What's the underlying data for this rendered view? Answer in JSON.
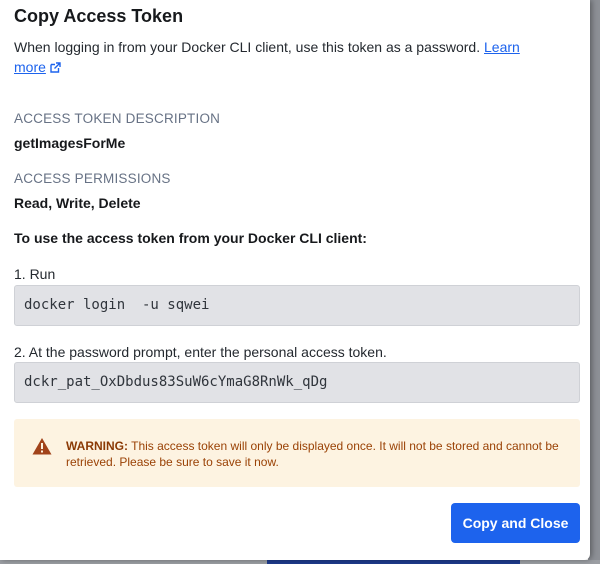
{
  "dialog": {
    "title": "Copy Access Token",
    "intro_text": "When logging in from your Docker CLI client, use this token as a password. ",
    "learn_more_label": "Learn more"
  },
  "token_description": {
    "label": "ACCESS TOKEN DESCRIPTION",
    "value": "getImagesForMe"
  },
  "permissions": {
    "label": "ACCESS PERMISSIONS",
    "value": "Read, Write, Delete"
  },
  "instructions": {
    "heading": "To use the access token from your Docker CLI client:",
    "step1_label": "1. Run",
    "step1_command": "docker login  -u sqwei",
    "step2_label": "2. At the password prompt, enter the personal access token.",
    "step2_token": "dckr_pat_OxDbdus83SuW6cYmaG8RnWk_qDg"
  },
  "warning": {
    "prefix": "WARNING:",
    "text": " This access token will only be displayed once. It will not be stored and cannot be retrieved. Please be sure to save it now.",
    "icon": "warning-triangle-icon"
  },
  "actions": {
    "copy_close_label": "Copy and Close"
  },
  "colors": {
    "primary": "#1d63ed",
    "warning_bg": "#fdf3e1",
    "warning_text": "#9a4206",
    "code_bg": "#e1e2e6"
  }
}
